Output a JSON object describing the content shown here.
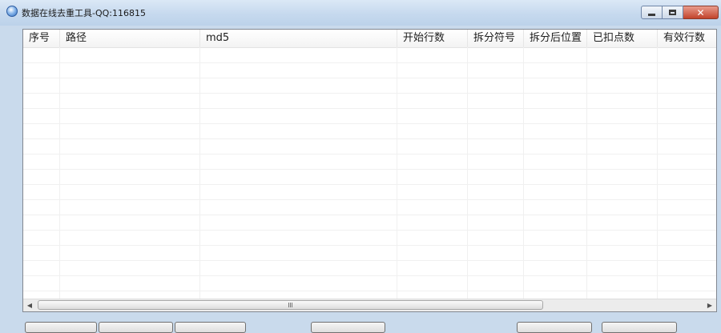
{
  "window": {
    "title": "数据在线去重工具-QQ:116815",
    "buttons": {
      "close_symbol": "✕"
    }
  },
  "listview": {
    "columns": [
      "序号",
      "路径",
      "md5",
      "开始行数",
      "拆分符号",
      "拆分后位置",
      "已扣点数",
      "有效行数"
    ],
    "rows": [],
    "scrollbar": {
      "grip_symbol": "III"
    }
  },
  "icons": {
    "app": "app-globe-icon",
    "minimize": "minimize-icon",
    "maximize": "maximize-icon",
    "close": "close-icon",
    "scroll_left": "arrow-left-icon",
    "scroll_right": "arrow-right-icon"
  },
  "colors": {
    "titlebar": "#c6d9ee",
    "close_button": "#c2432b",
    "background": "#c9daec"
  }
}
